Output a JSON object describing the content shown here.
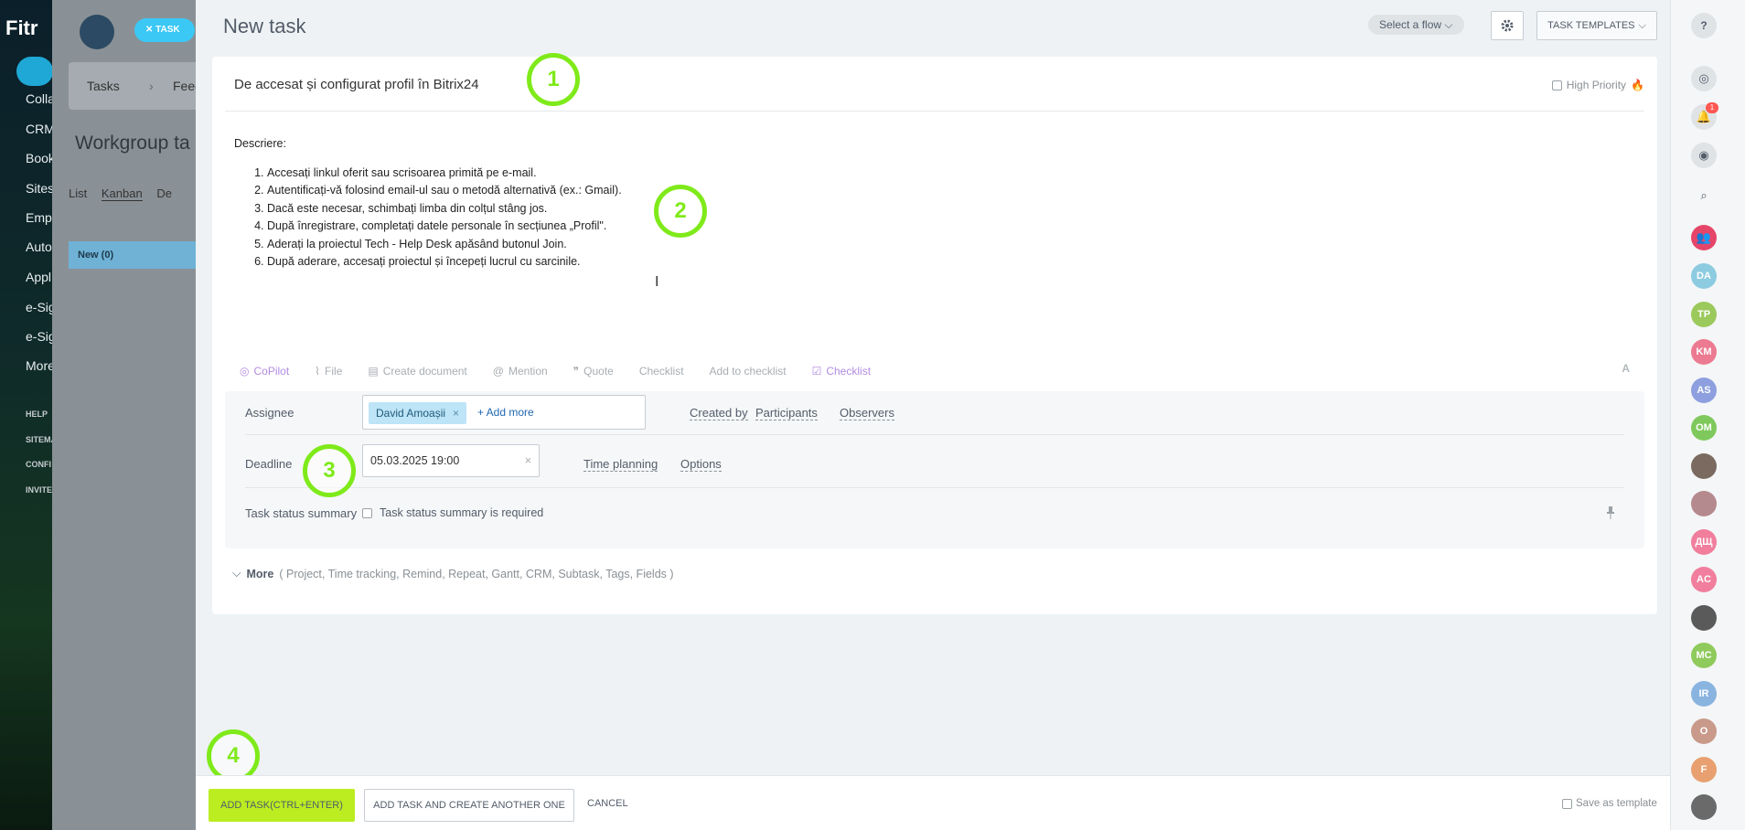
{
  "left_app": {
    "logo": "Fitr",
    "nav_items": [
      "Colla",
      "CRM",
      "Book",
      "Sites",
      "Empl",
      "Auto",
      "Appl",
      "e-Sig",
      "e-Sig",
      "More"
    ],
    "small_items": [
      "HELP",
      "SITEMA",
      "CONFI",
      "INVITE"
    ]
  },
  "bg_page": {
    "task_chip": "TASK",
    "tabs": [
      "Tasks",
      "Feed"
    ],
    "title": "Workgroup ta",
    "view_tabs": [
      "List",
      "Kanban",
      "De"
    ],
    "kanban_column": "New (0)"
  },
  "slider": {
    "title": "New task",
    "flow_select": "Select a flow",
    "templates_button": "TASK TEMPLATES",
    "task_title": "De accesat și configurat profil în Bitrix24",
    "high_priority": "High Priority",
    "description": {
      "label": "Descriere:",
      "items": [
        "Accesați linkul oferit sau scrisoarea primită pe e-mail.",
        "Autentificați-vă folosind email-ul sau o metodă alternativă (ex.: Gmail).",
        "Dacă este necesar, schimbați limba din colțul stâng jos.",
        "După înregistrare, completați datele personale în secțiunea „Profil\".",
        "Aderați la proiectul Tech - Help Desk apăsând butonul Join.",
        "După aderare, accesați proiectul și începeți lucrul cu sarcinile."
      ]
    },
    "toolbar": {
      "copilot": "CoPilot",
      "file": "File",
      "create_document": "Create document",
      "mention": "Mention",
      "quote": "Quote",
      "checklist": "Checklist",
      "add_to_checklist": "Add to checklist",
      "checklist2": "Checklist",
      "font": "A"
    },
    "fields": {
      "assignee_label": "Assignee",
      "assignee_name": "David Amoașii",
      "add_more": "+ Add more",
      "created_by": "Created by",
      "participants": "Participants",
      "observers": "Observers",
      "deadline_label": "Deadline",
      "deadline_value": "05.03.2025 19:00",
      "time_planning": "Time planning",
      "options": "Options",
      "summary_label": "Task status summary",
      "summary_check": "Task status summary is required"
    },
    "more": {
      "label": "More",
      "items": "( Project,  Time tracking,  Remind,  Repeat,  Gantt,  CRM,  Subtask,  Tags,  Fields )"
    },
    "footer": {
      "add_task": "ADD TASK(CTRL+ENTER)",
      "add_another": "ADD TASK AND CREATE ANOTHER ONE",
      "cancel": "CANCEL",
      "save_template": "Save as template"
    }
  },
  "annotations": [
    "1",
    "2",
    "3",
    "4"
  ],
  "right_bar": {
    "notification_count": "1",
    "avatars": [
      {
        "initials": "DA",
        "color": "#8ccbe0"
      },
      {
        "initials": "TP",
        "color": "#9cc95c"
      },
      {
        "initials": "KM",
        "color": "#ec7a90"
      },
      {
        "initials": "AS",
        "color": "#8e9fe0"
      },
      {
        "initials": "OM",
        "color": "#7fc95c"
      },
      {
        "initials": "",
        "color": "#7a6a60"
      },
      {
        "initials": "",
        "color": "#b58a8e"
      },
      {
        "initials": "ДЩ",
        "color": "#f07e9c"
      },
      {
        "initials": "AC",
        "color": "#f07e9c"
      },
      {
        "initials": "",
        "color": "#5a5a5a"
      },
      {
        "initials": "MC",
        "color": "#8fca5c"
      },
      {
        "initials": "IR",
        "color": "#8ab4e0"
      },
      {
        "initials": "O",
        "color": "#c99a8a"
      },
      {
        "initials": "F",
        "color": "#e8a070"
      },
      {
        "initials": "",
        "color": "#6a6a6a"
      }
    ]
  }
}
